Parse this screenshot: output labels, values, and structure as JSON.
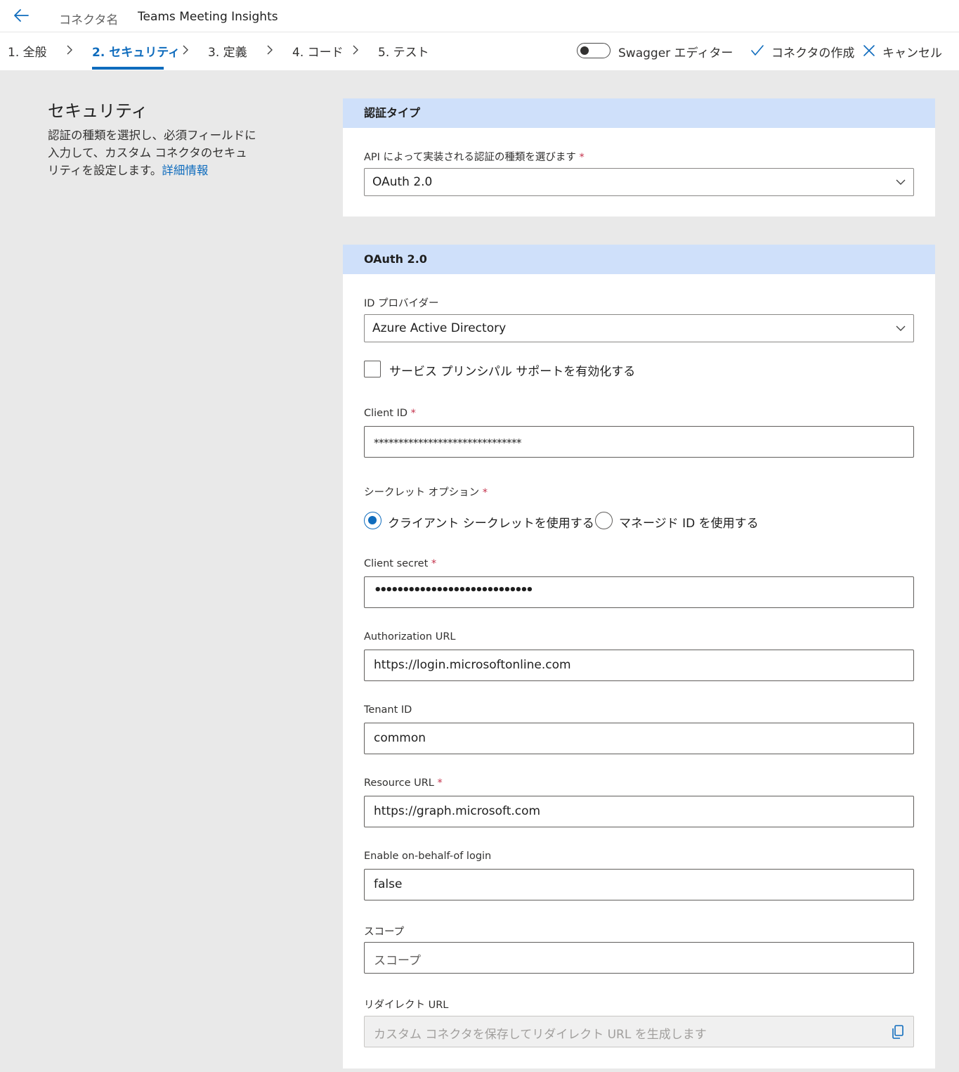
{
  "header": {
    "connector_label": "コネクタ名",
    "connector_name": "Teams Meeting Insights"
  },
  "steps": [
    {
      "label": "1. 全般"
    },
    {
      "label": "2. セキュリティ",
      "active": true
    },
    {
      "label": "3. 定義"
    },
    {
      "label": "4. コード"
    },
    {
      "label": "5. テスト"
    }
  ],
  "toolbar": {
    "swagger_toggle_label": "Swagger エディター",
    "swagger_toggle_on": false,
    "create_label": "コネクタの作成",
    "cancel_label": "キャンセル"
  },
  "left_panel": {
    "title": "セキュリティ",
    "description": "認証の種類を選択し、必須フィールドに入力して、カスタム コネクタのセキュリティを設定します。",
    "link": "詳細情報"
  },
  "auth_type_card": {
    "heading": "認証タイプ",
    "field_label": "API によって実装される認証の種類を選びます",
    "required_mark": "*",
    "selected": "OAuth 2.0"
  },
  "oauth_card": {
    "heading": "OAuth 2.0",
    "idp_label": "ID プロバイダー",
    "idp_selected": "Azure Active Directory",
    "service_principal_label": "サービス プリンシパル サポートを有効化する",
    "service_principal_checked": false,
    "client_id_label": "Client ID",
    "client_id_value": "******************************",
    "secret_option_label": "シークレット オプション",
    "secret_options": [
      {
        "label": "クライアント シークレットを使用する",
        "checked": true
      },
      {
        "label": "マネージド ID を使用する",
        "checked": false
      }
    ],
    "client_secret_label": "Client secret",
    "client_secret_value": "••••••••••••••••••••••••••••",
    "authorization_url_label": "Authorization URL",
    "authorization_url_value": "https://login.microsoftonline.com",
    "tenant_id_label": "Tenant ID",
    "tenant_id_value": "common",
    "resource_url_label": "Resource URL",
    "resource_url_value": "https://graph.microsoft.com",
    "obo_label": "Enable on-behalf-of login",
    "obo_value": "false",
    "scope_label": "スコープ",
    "scope_placeholder": "スコープ",
    "redirect_label": "リダイレクト URL",
    "redirect_placeholder": "カスタム コネクタを保存してリダイレクト URL を生成します"
  },
  "colors": {
    "accent": "#0f6cbd",
    "card_header": "#cfe0fa",
    "page_bg": "#e9e9e9",
    "required": "#c4314b"
  }
}
